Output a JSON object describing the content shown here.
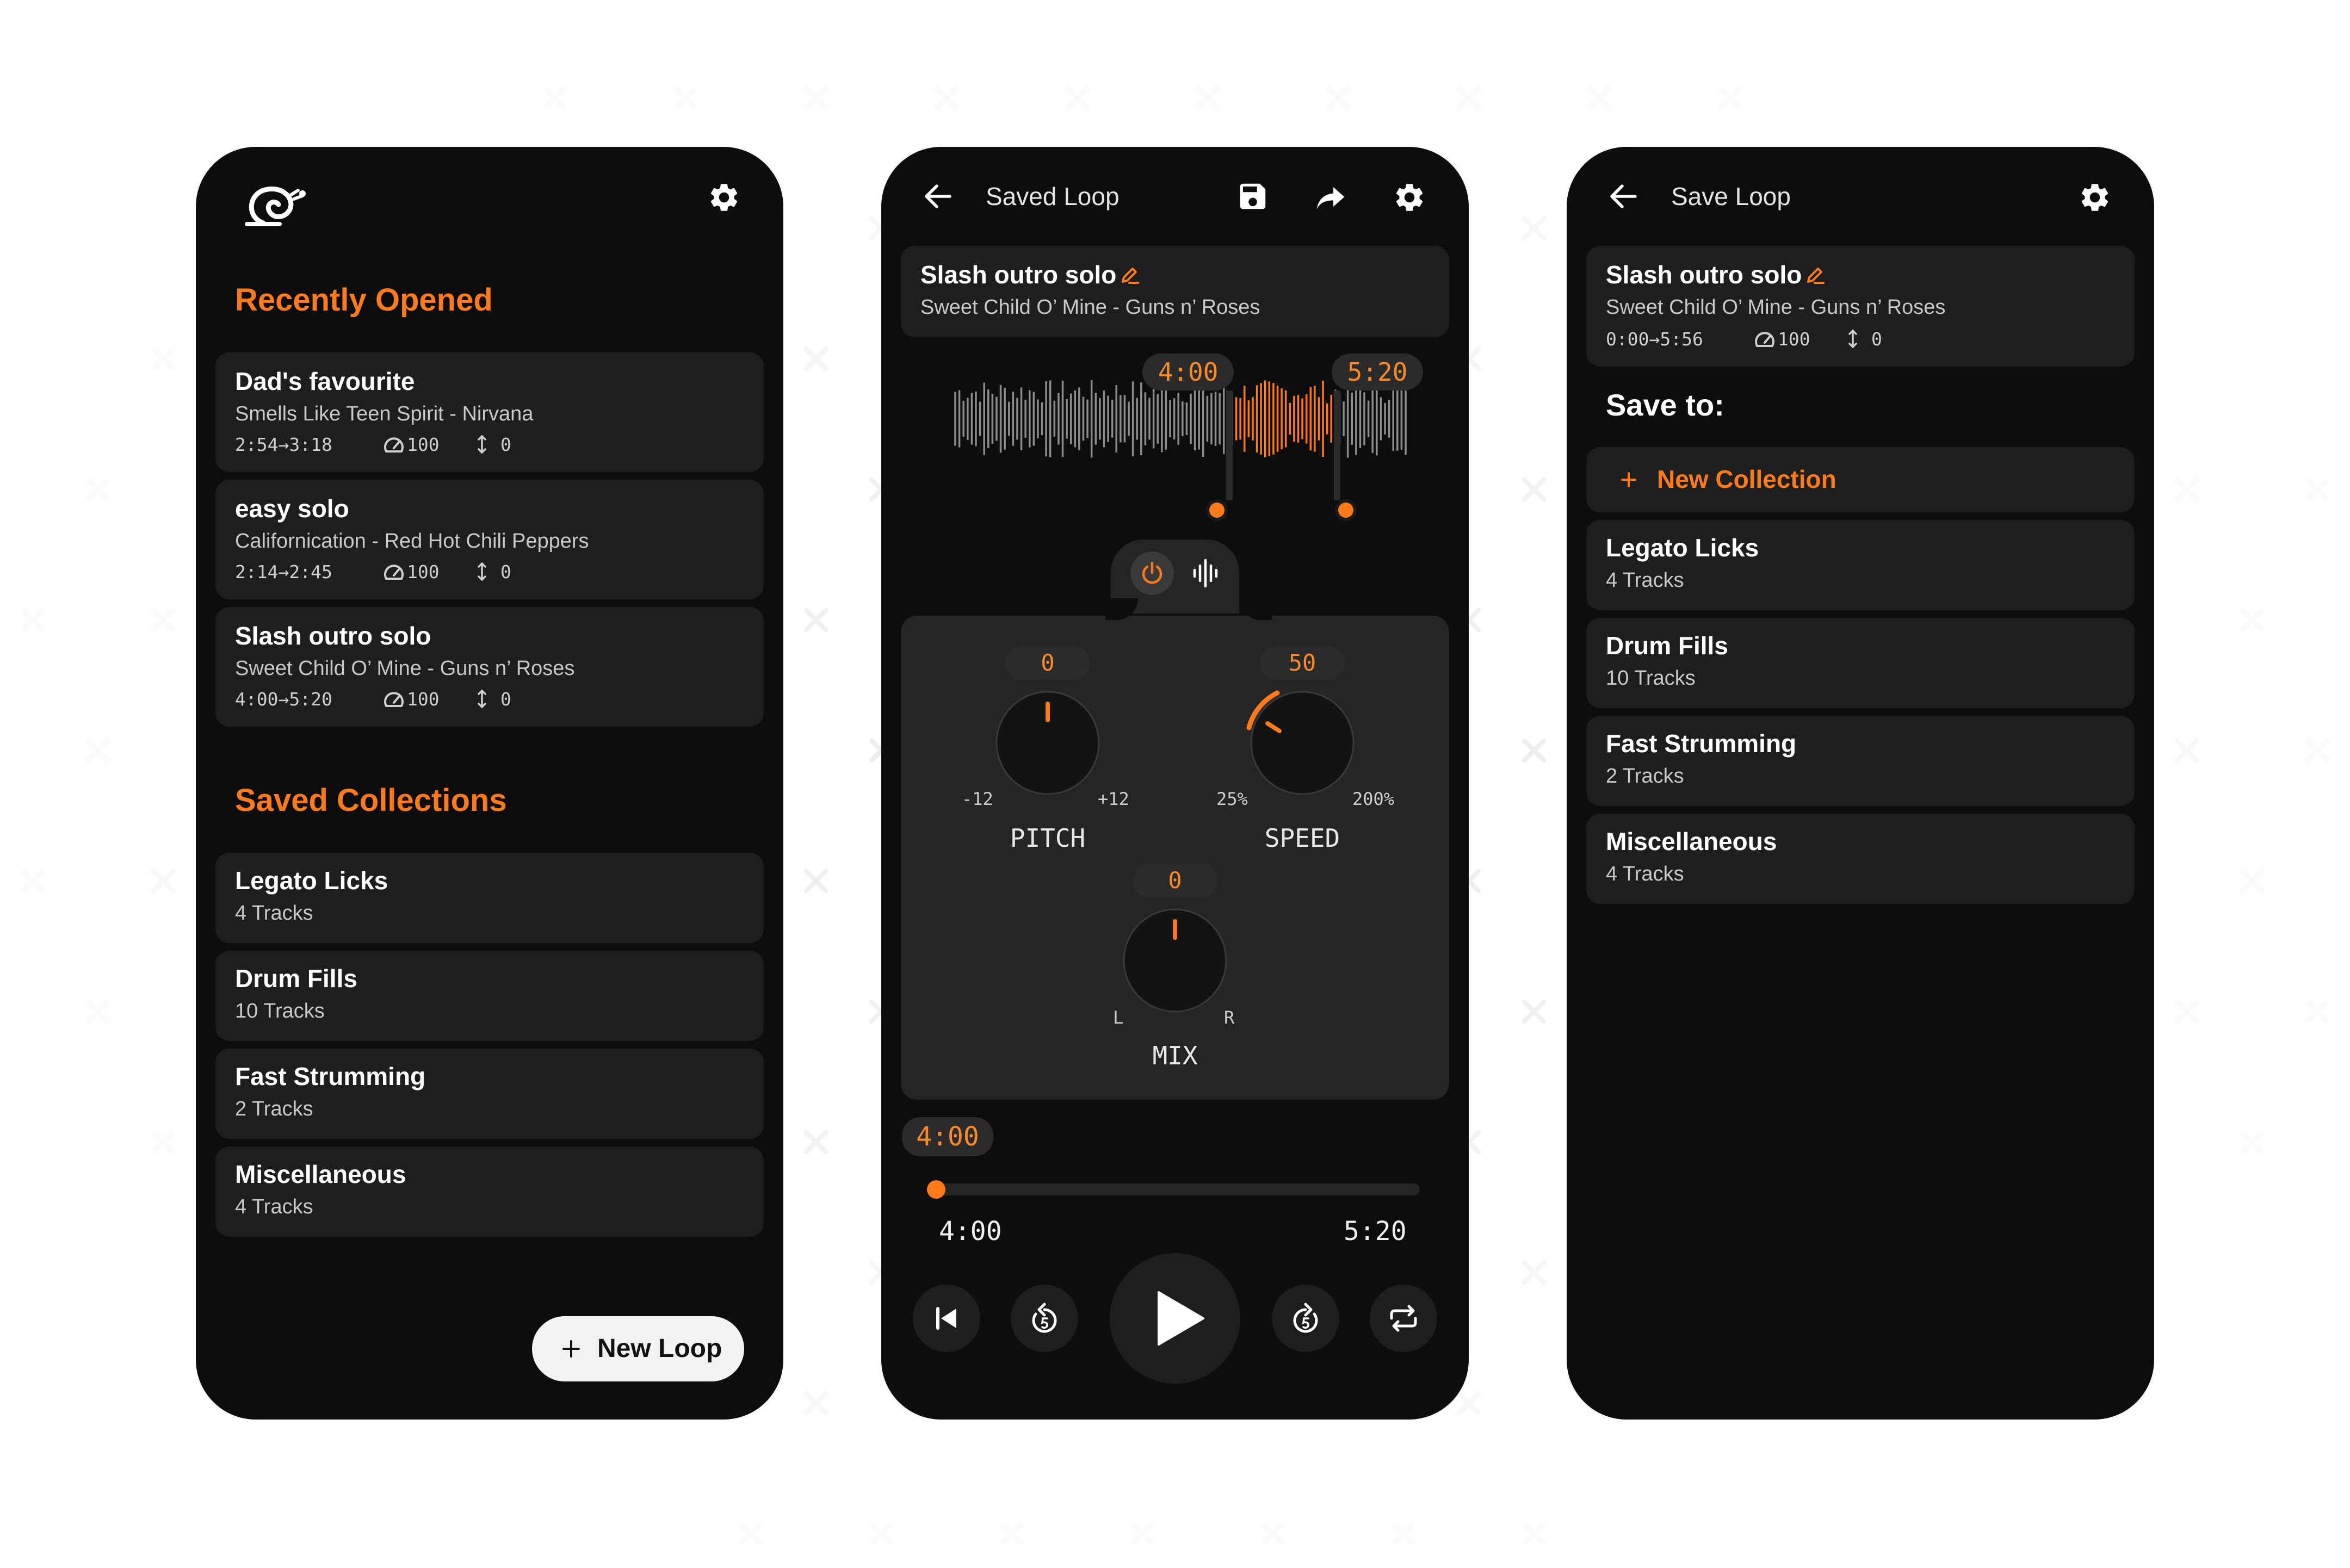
{
  "colors": {
    "accent": "#ff7a1a",
    "surface": "#0d0d0d",
    "card": "#1e1e1e",
    "panel": "#252525"
  },
  "home": {
    "logo_icon": "snail-logo-icon",
    "settings_icon": "gear-icon",
    "recent_heading": "Recently Opened",
    "recent": [
      {
        "title": "Dad's favourite",
        "subtitle": "Smells Like Teen Spirit - Nirvana",
        "range": "2:54→3:18",
        "speed": "100",
        "pitch": "0"
      },
      {
        "title": "easy solo",
        "subtitle": "Californication - Red Hot Chili Peppers",
        "range": "2:14→2:45",
        "speed": "100",
        "pitch": "0"
      },
      {
        "title": "Slash outro solo",
        "subtitle": "Sweet Child O’ Mine - Guns n’ Roses",
        "range": "4:00→5:20",
        "speed": "100",
        "pitch": "0"
      }
    ],
    "collections_heading": "Saved Collections",
    "collections": [
      {
        "name": "Legato Licks",
        "count": "4 Tracks"
      },
      {
        "name": "Drum Fills",
        "count": "10 Tracks"
      },
      {
        "name": "Fast Strumming",
        "count": "2 Tracks"
      },
      {
        "name": "Miscellaneous",
        "count": "4 Tracks"
      }
    ],
    "new_loop_label": "New Loop"
  },
  "player": {
    "title": "Saved Loop",
    "loop_title": "Slash outro solo",
    "loop_subtitle": "Sweet Child O’ Mine - Guns n’ Roses",
    "start_marker": "4:00",
    "end_marker": "5:20",
    "pitch": {
      "value": "0",
      "min": "-12",
      "max": "+12",
      "label": "PITCH"
    },
    "speed": {
      "value": "50",
      "min": "25%",
      "max": "200%",
      "label": "SPEED"
    },
    "mix": {
      "value": "0",
      "left": "L",
      "right": "R",
      "label": "MIX"
    },
    "position_badge": "4:00",
    "position_start": "4:00",
    "position_end": "5:20",
    "progress_fraction": 0.0
  },
  "save": {
    "title": "Save Loop",
    "loop_title": "Slash outro solo",
    "loop_subtitle": "Sweet Child O’ Mine - Guns n’ Roses",
    "range": "0:00→5:56",
    "speed": "100",
    "pitch": "0",
    "save_to_heading": "Save to:",
    "new_collection_label": "New Collection",
    "collections": [
      {
        "name": "Legato Licks",
        "count": "4 Tracks"
      },
      {
        "name": "Drum Fills",
        "count": "10 Tracks"
      },
      {
        "name": "Fast Strumming",
        "count": "2 Tracks"
      },
      {
        "name": "Miscellaneous",
        "count": "4 Tracks"
      }
    ]
  }
}
